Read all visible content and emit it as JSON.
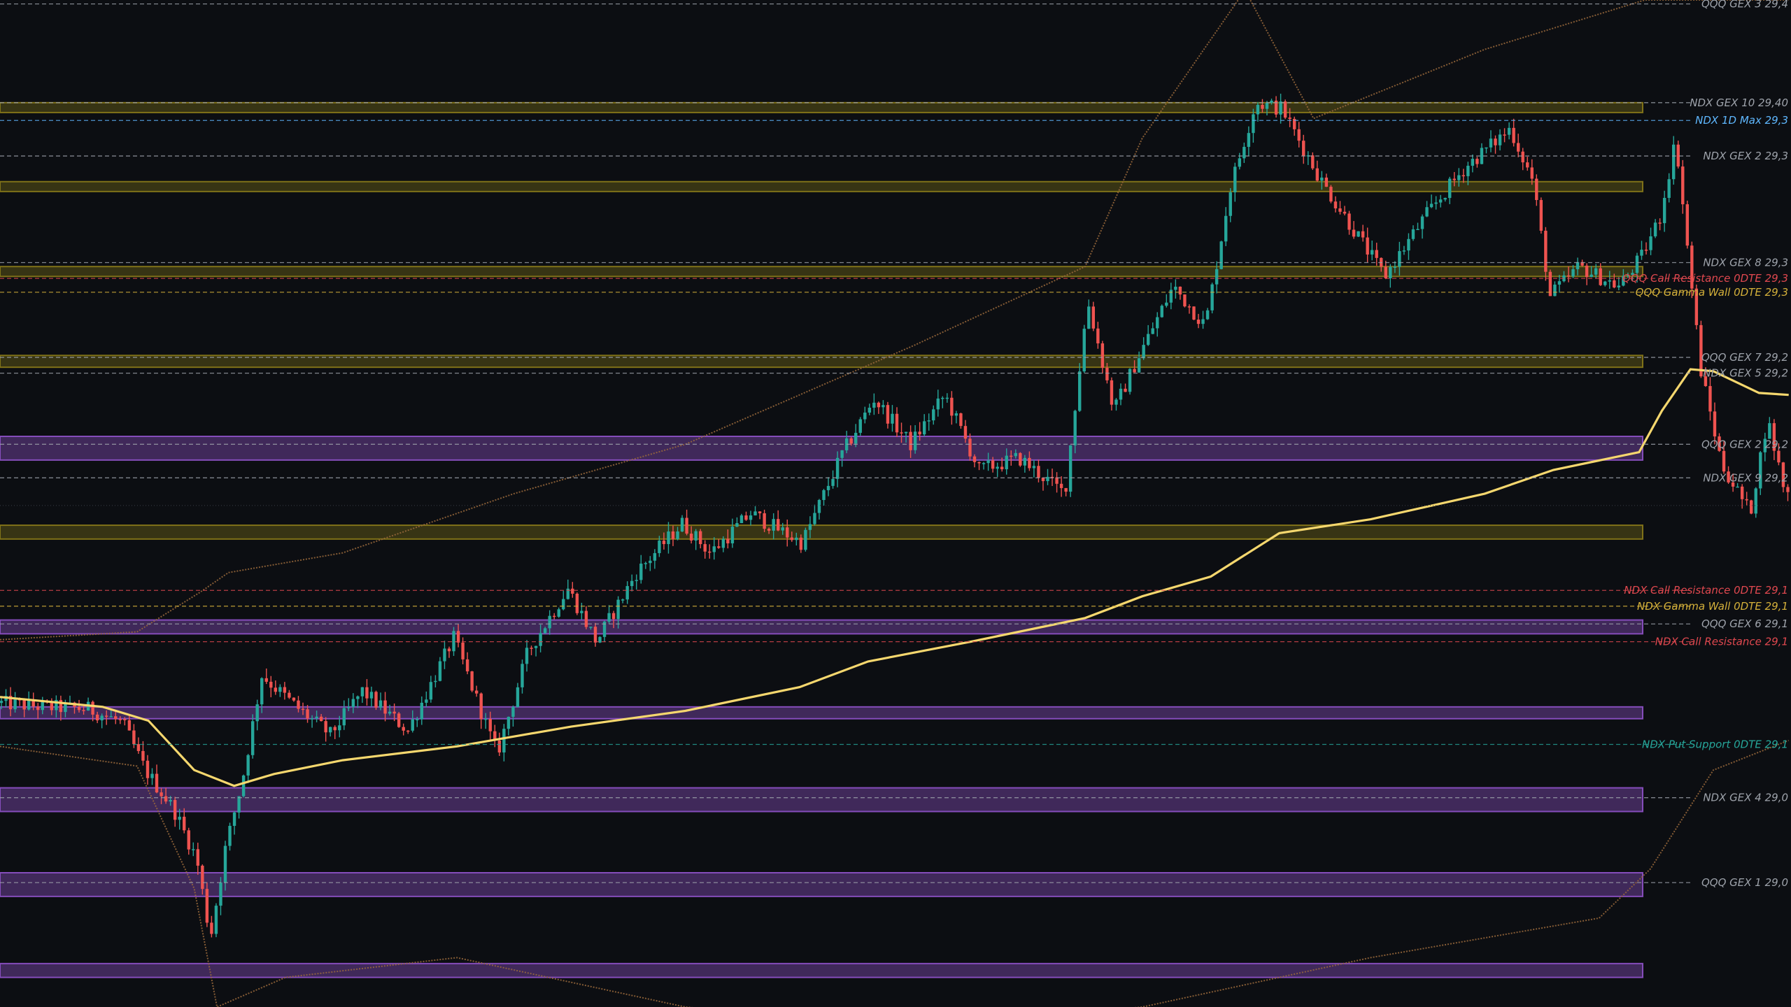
{
  "colors": {
    "background": "#0c0e12",
    "bull_candle": "#26a69a",
    "bear_candle": "#ef5350",
    "vwap": "#f5d76e",
    "band": "#9b6a3c",
    "zone_gold": "#8a7a1a",
    "zone_purple": "#8f52c9",
    "label_gray": "#9ea3ab",
    "label_blue": "#5fb8ff",
    "label_red": "#e0484f",
    "label_gold": "#d4b03a",
    "label_green": "#26a69a"
  },
  "chart_data": {
    "type": "candlestick",
    "title": "",
    "price_axis": {
      "min": 28960,
      "max": 29470
    },
    "levels": [
      {
        "label": "QQQ GEX 3 29,4",
        "price": 29468,
        "color": "#9ea3ab"
      },
      {
        "label": "NDX GEX 10 29,40",
        "price": 29418,
        "color": "#9ea3ab"
      },
      {
        "label": "NDX 1D Max 29,3",
        "price": 29409,
        "color": "#5fb8ff"
      },
      {
        "label": "NDX GEX 2 29,3",
        "price": 29391,
        "color": "#9ea3ab"
      },
      {
        "label": "NDX GEX 8 29,3",
        "price": 29337,
        "color": "#9ea3ab"
      },
      {
        "label": "QQQ Call Resistance 0DTE 29,3",
        "price": 29329,
        "color": "#e0484f"
      },
      {
        "label": "QQQ Gamma Wall 0DTE 29,3",
        "price": 29322,
        "color": "#d4b03a"
      },
      {
        "label": "QQQ GEX 7 29,2",
        "price": 29289,
        "color": "#9ea3ab"
      },
      {
        "label": "NDX GEX 5 29,2",
        "price": 29281,
        "color": "#9ea3ab"
      },
      {
        "label": "QQQ GEX 2 29,2",
        "price": 29245,
        "color": "#9ea3ab"
      },
      {
        "label": "NDX GEX 9 29,2",
        "price": 29228,
        "color": "#9ea3ab"
      },
      {
        "label": "NDX Call Resistance 0DTE 29,1",
        "price": 29171,
        "color": "#e0484f"
      },
      {
        "label": "NDX Gamma Wall 0DTE 29,1",
        "price": 29163,
        "color": "#d4b03a"
      },
      {
        "label": "QQQ GEX 6 29,1",
        "price": 29154,
        "color": "#9ea3ab"
      },
      {
        "label": "NDX Call Resistance 29,1",
        "price": 29145,
        "color": "#e0484f"
      },
      {
        "label": "NDX Put Support 0DTE 29,1",
        "price": 29093,
        "color": "#26a69a"
      },
      {
        "label": "NDX GEX 4 29,0",
        "price": 29066,
        "color": "#9ea3ab"
      },
      {
        "label": "QQQ GEX 1 29,0",
        "price": 29023,
        "color": "#9ea3ab"
      }
    ],
    "zones": [
      {
        "from": 29418,
        "to": 29413,
        "color": "gold"
      },
      {
        "from": 29378,
        "to": 29373,
        "color": "gold"
      },
      {
        "from": 29335,
        "to": 29330,
        "color": "gold"
      },
      {
        "from": 29290,
        "to": 29284,
        "color": "gold"
      },
      {
        "from": 29249,
        "to": 29237,
        "color": "purple"
      },
      {
        "from": 29204,
        "to": 29197,
        "color": "gold"
      },
      {
        "from": 29156,
        "to": 29149,
        "color": "purple"
      },
      {
        "from": 29112,
        "to": 29106,
        "color": "purple"
      },
      {
        "from": 29071,
        "to": 29059,
        "color": "purple"
      },
      {
        "from": 29028,
        "to": 29016,
        "color": "purple"
      },
      {
        "from": 28982,
        "to": 28975,
        "color": "purple"
      }
    ],
    "path_nodes": [
      {
        "t": 0,
        "p": 29114
      },
      {
        "t": 40,
        "p": 29112
      },
      {
        "t": 80,
        "p": 29111
      },
      {
        "t": 110,
        "p": 29104
      },
      {
        "t": 130,
        "p": 29080
      },
      {
        "t": 155,
        "p": 29060
      },
      {
        "t": 175,
        "p": 29035
      },
      {
        "t": 187,
        "p": 28995
      },
      {
        "t": 200,
        "p": 29040
      },
      {
        "t": 215,
        "p": 29075
      },
      {
        "t": 232,
        "p": 29128
      },
      {
        "t": 262,
        "p": 29112
      },
      {
        "t": 292,
        "p": 29098
      },
      {
        "t": 320,
        "p": 29120
      },
      {
        "t": 360,
        "p": 29100
      },
      {
        "t": 400,
        "p": 29147
      },
      {
        "t": 438,
        "p": 29088
      },
      {
        "t": 465,
        "p": 29140
      },
      {
        "t": 500,
        "p": 29172
      },
      {
        "t": 525,
        "p": 29145
      },
      {
        "t": 560,
        "p": 29180
      },
      {
        "t": 600,
        "p": 29205
      },
      {
        "t": 625,
        "p": 29190
      },
      {
        "t": 660,
        "p": 29210
      },
      {
        "t": 705,
        "p": 29195
      },
      {
        "t": 740,
        "p": 29240
      },
      {
        "t": 768,
        "p": 29268
      },
      {
        "t": 800,
        "p": 29245
      },
      {
        "t": 830,
        "p": 29270
      },
      {
        "t": 860,
        "p": 29232
      },
      {
        "t": 895,
        "p": 29238
      },
      {
        "t": 935,
        "p": 29220
      },
      {
        "t": 955,
        "p": 29318
      },
      {
        "t": 978,
        "p": 29262
      },
      {
        "t": 1000,
        "p": 29290
      },
      {
        "t": 1030,
        "p": 29325
      },
      {
        "t": 1058,
        "p": 29305
      },
      {
        "t": 1080,
        "p": 29375
      },
      {
        "t": 1102,
        "p": 29418
      },
      {
        "t": 1125,
        "p": 29415
      },
      {
        "t": 1160,
        "p": 29378
      },
      {
        "t": 1215,
        "p": 29330
      },
      {
        "t": 1250,
        "p": 29360
      },
      {
        "t": 1285,
        "p": 29385
      },
      {
        "t": 1325,
        "p": 29405
      },
      {
        "t": 1345,
        "p": 29378
      },
      {
        "t": 1360,
        "p": 29320
      },
      {
        "t": 1385,
        "p": 29335
      },
      {
        "t": 1420,
        "p": 29325
      },
      {
        "t": 1440,
        "p": 29340
      },
      {
        "t": 1456,
        "p": 29360
      },
      {
        "t": 1470,
        "p": 29400
      },
      {
        "t": 1480,
        "p": 29345
      },
      {
        "t": 1492,
        "p": 29282
      },
      {
        "t": 1510,
        "p": 29235
      },
      {
        "t": 1535,
        "p": 29210
      },
      {
        "t": 1550,
        "p": 29258
      },
      {
        "t": 1566,
        "p": 29220
      }
    ],
    "vwap": [
      {
        "t": 0,
        "p": 29117
      },
      {
        "t": 90,
        "p": 29112
      },
      {
        "t": 130,
        "p": 29105
      },
      {
        "t": 170,
        "p": 29080
      },
      {
        "t": 205,
        "p": 29072
      },
      {
        "t": 240,
        "p": 29078
      },
      {
        "t": 300,
        "p": 29085
      },
      {
        "t": 400,
        "p": 29092
      },
      {
        "t": 500,
        "p": 29102
      },
      {
        "t": 600,
        "p": 29110
      },
      {
        "t": 700,
        "p": 29122
      },
      {
        "t": 760,
        "p": 29135
      },
      {
        "t": 850,
        "p": 29145
      },
      {
        "t": 950,
        "p": 29157
      },
      {
        "t": 1000,
        "p": 29168
      },
      {
        "t": 1060,
        "p": 29178
      },
      {
        "t": 1120,
        "p": 29200
      },
      {
        "t": 1200,
        "p": 29207
      },
      {
        "t": 1300,
        "p": 29220
      },
      {
        "t": 1360,
        "p": 29232
      },
      {
        "t": 1435,
        "p": 29241
      },
      {
        "t": 1455,
        "p": 29262
      },
      {
        "t": 1480,
        "p": 29283
      },
      {
        "t": 1500,
        "p": 29282
      },
      {
        "t": 1540,
        "p": 29271
      },
      {
        "t": 1566,
        "p": 29270
      }
    ],
    "upper_band": [
      {
        "t": 0,
        "p": 29146
      },
      {
        "t": 120,
        "p": 29150
      },
      {
        "t": 175,
        "p": 29170
      },
      {
        "t": 200,
        "p": 29180
      },
      {
        "t": 300,
        "p": 29190
      },
      {
        "t": 450,
        "p": 29220
      },
      {
        "t": 600,
        "p": 29245
      },
      {
        "t": 700,
        "p": 29270
      },
      {
        "t": 800,
        "p": 29295
      },
      {
        "t": 950,
        "p": 29335
      },
      {
        "t": 1000,
        "p": 29400
      },
      {
        "t": 1090,
        "p": 29475
      },
      {
        "t": 1150,
        "p": 29410
      },
      {
        "t": 1300,
        "p": 29445
      },
      {
        "t": 1440,
        "p": 29470
      },
      {
        "t": 1566,
        "p": 29470
      }
    ],
    "lower_band": [
      {
        "t": 0,
        "p": 29092
      },
      {
        "t": 120,
        "p": 29082
      },
      {
        "t": 170,
        "p": 29020
      },
      {
        "t": 190,
        "p": 28960
      },
      {
        "t": 250,
        "p": 28975
      },
      {
        "t": 400,
        "p": 28985
      },
      {
        "t": 600,
        "p": 28960
      },
      {
        "t": 800,
        "p": 28950
      },
      {
        "t": 1000,
        "p": 28960
      },
      {
        "t": 1200,
        "p": 28985
      },
      {
        "t": 1400,
        "p": 29005
      },
      {
        "t": 1445,
        "p": 29030
      },
      {
        "t": 1500,
        "p": 29080
      },
      {
        "t": 1566,
        "p": 29095
      }
    ]
  }
}
